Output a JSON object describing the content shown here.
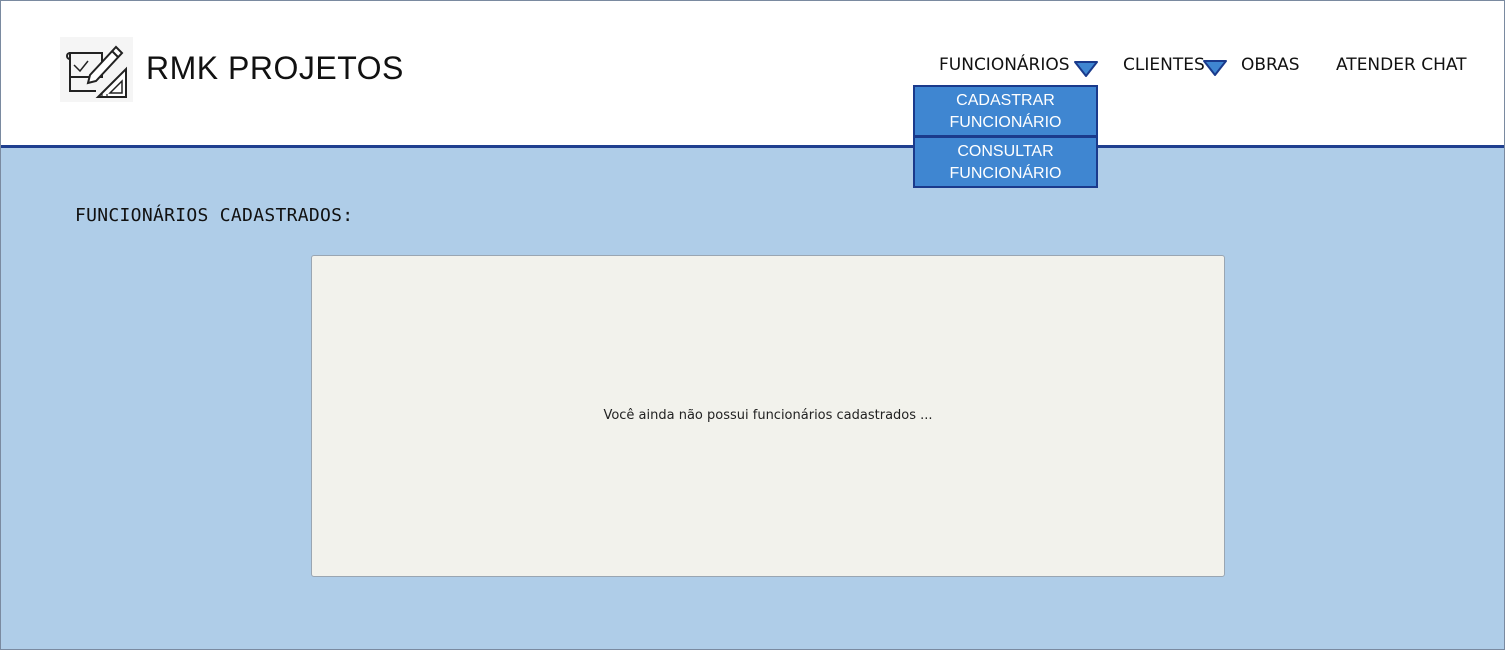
{
  "header": {
    "brand": "RMK PROJETOS",
    "logo_icon": "blueprint-pencil-icon"
  },
  "nav": {
    "funcionarios": "FUNCIONÁRIOS",
    "clientes": "CLIENTES",
    "obras": "OBRAS",
    "atender_chat": "ATENDER CHAT"
  },
  "dropdown": {
    "cadastrar_line1": "CADASTRAR",
    "cadastrar_line2": "FUNCIONÁRIO",
    "consultar_line1": "CONSULTAR",
    "consultar_line2": "FUNCIONÁRIO"
  },
  "main": {
    "title": "FUNCIONÁRIOS CADASTRADOS:",
    "empty_message": "Você ainda não possui funcionários cadastrados ..."
  },
  "colors": {
    "header_bg": "#ffffff",
    "header_line": "#1f3f8f",
    "main_bg": "#afcde8",
    "dropdown_bg": "#3f86d1",
    "dropdown_border": "#1a3a8c",
    "panel_bg": "#f2f2ec"
  }
}
